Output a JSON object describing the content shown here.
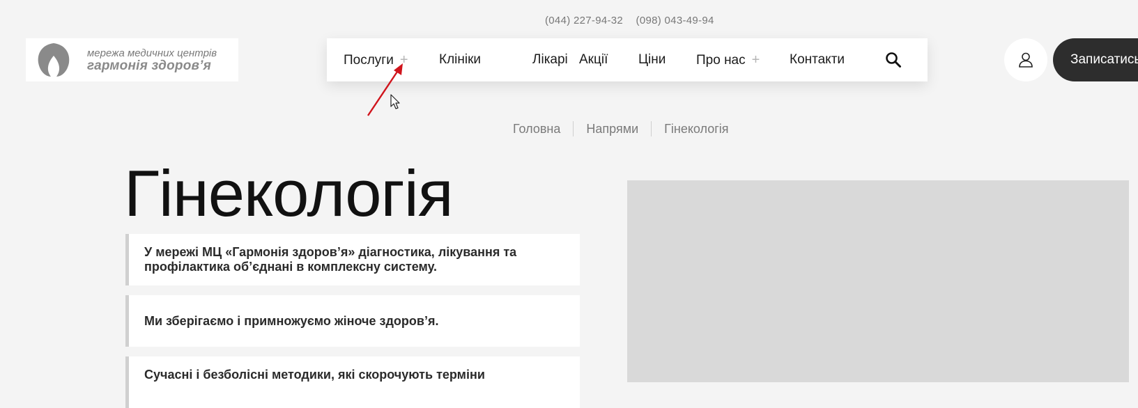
{
  "header": {
    "phones": [
      "(044) 227-94-32",
      "(098) 043-49-94"
    ],
    "logo": {
      "line1": "мережа медичних центрів",
      "line2": "гармонія здоров’я"
    }
  },
  "nav": {
    "items": [
      {
        "label": "Послуги",
        "has_submenu": true
      },
      {
        "label": "Клініки",
        "has_submenu": false
      },
      {
        "label": "Лікарі",
        "has_submenu": false
      },
      {
        "label": "Акції",
        "has_submenu": false
      },
      {
        "label": "Ціни",
        "has_submenu": false
      },
      {
        "label": "Про нас",
        "has_submenu": true
      },
      {
        "label": "Контакти",
        "has_submenu": false
      }
    ],
    "submenu_icon": "plus-icon",
    "search_icon": "search-icon"
  },
  "actions": {
    "account_icon": "user-icon",
    "book_label": "Записатись"
  },
  "breadcrumb": [
    "Головна",
    "Напрями",
    "Гінекологія"
  ],
  "main": {
    "title": "Гінекологія",
    "cards": [
      "У мережі МЦ «Гармонія здоров’я» діагностика, лікування та профілактика об’єднані в комплексну систему.",
      "Ми зберігаємо і примножуємо жіноче здоров’я.",
      "Сучасні і безболісні методики, які скорочують терміни"
    ]
  },
  "colors": {
    "background": "#f4f4f4",
    "book_button": "#2d2d2d",
    "annotation_arrow": "#d0141c"
  }
}
